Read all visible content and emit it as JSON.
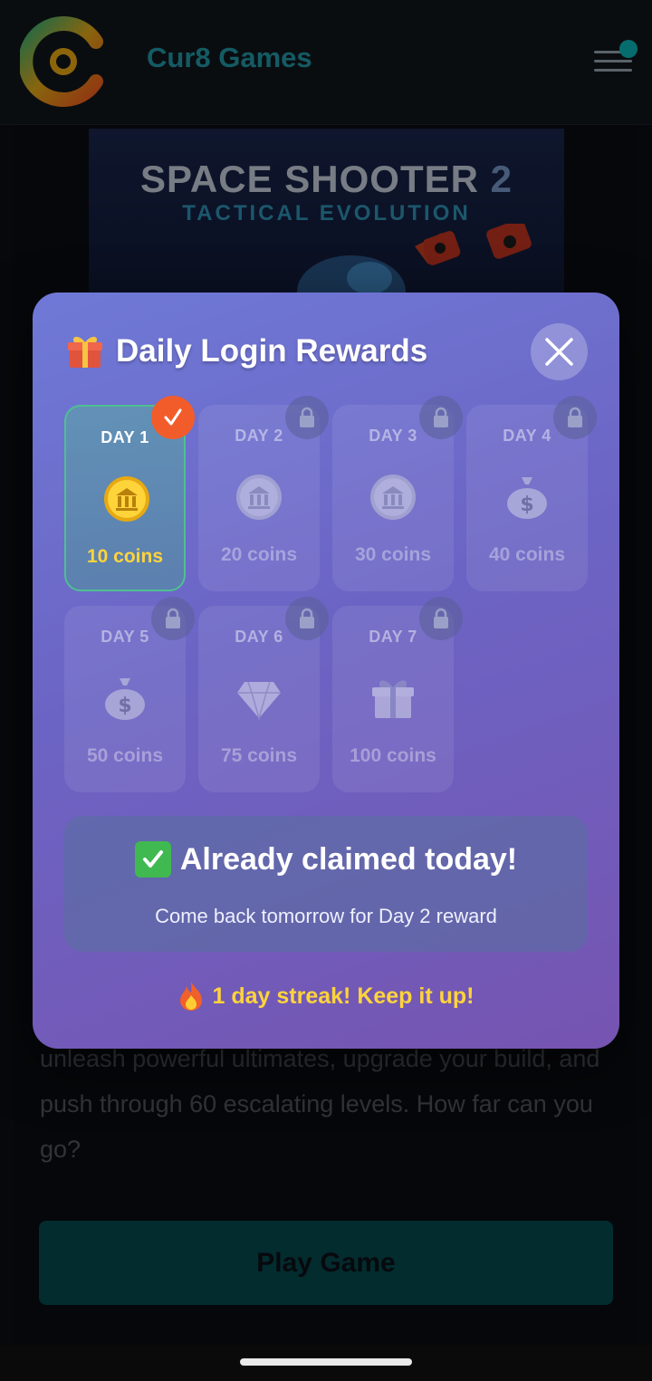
{
  "header": {
    "brand": "Cur8 Games",
    "logo_icon": "cur8-logo-icon",
    "menu_icon": "hamburger-menu-icon"
  },
  "banner": {
    "title": "SPACE SHOOTER",
    "title_num": "2",
    "subtitle": "TACTICAL EVOLUTION"
  },
  "description": "unleash powerful ultimates, upgrade your build, and push through 60 escalating levels. How far can you go?",
  "play_button": "Play Game",
  "modal": {
    "title": "Daily Login Rewards",
    "title_icon": "gift-icon",
    "close_icon": "close-icon",
    "days": [
      {
        "label": "DAY 1",
        "amount": "10 coins",
        "icon": "gold-coin-icon",
        "status": "claimed"
      },
      {
        "label": "DAY 2",
        "amount": "20 coins",
        "icon": "silver-coin-icon",
        "status": "locked"
      },
      {
        "label": "DAY 3",
        "amount": "30 coins",
        "icon": "silver-coin-icon",
        "status": "locked"
      },
      {
        "label": "DAY 4",
        "amount": "40 coins",
        "icon": "money-bag-icon",
        "status": "locked"
      },
      {
        "label": "DAY 5",
        "amount": "50 coins",
        "icon": "money-bag-icon",
        "status": "locked"
      },
      {
        "label": "DAY 6",
        "amount": "75 coins",
        "icon": "diamond-icon",
        "status": "locked"
      },
      {
        "label": "DAY 7",
        "amount": "100 coins",
        "icon": "gift-box-icon",
        "status": "locked"
      }
    ],
    "claimed_title": "Already claimed today!",
    "claimed_subtitle": "Come back tomorrow for Day 2 reward",
    "streak": "1 day streak! Keep it up!"
  },
  "colors": {
    "accent_teal": "#0aa7a8",
    "claimed_green": "#4fbf92",
    "coin_yellow": "#ffd43b",
    "check_orange": "#f25c2b"
  }
}
